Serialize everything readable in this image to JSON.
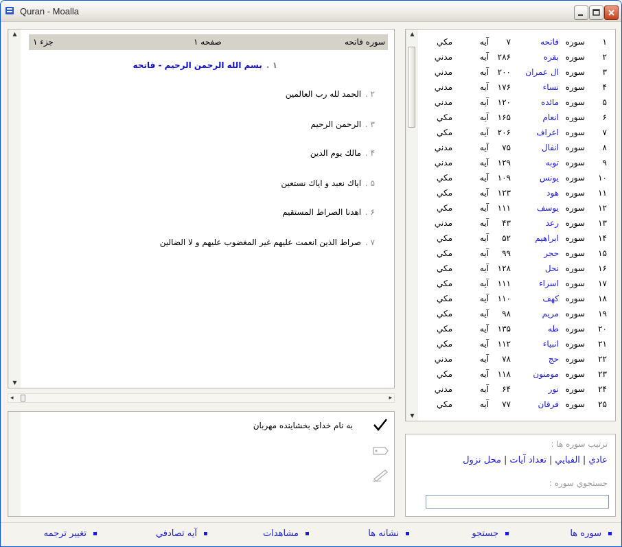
{
  "window": {
    "title": "Quran - Moalla"
  },
  "reader": {
    "header": {
      "surah": "سوره فاتحه",
      "page": "صفحه ۱",
      "juz": "جزء ۱"
    },
    "verses": [
      {
        "num": "۱ .",
        "text": "بسم الله الرحمن الرحيم - فاتحه"
      },
      {
        "num": "۲ .",
        "text": "الحمد لله رب العالمين"
      },
      {
        "num": "۳ .",
        "text": "الرحمن الرحيم"
      },
      {
        "num": "۴ .",
        "text": "مالك يوم الدين"
      },
      {
        "num": "۵ .",
        "text": "اياك نعبد و اياك نستعين"
      },
      {
        "num": "۶ .",
        "text": "اهدنا الصراط المستقيم"
      },
      {
        "num": "۷ .",
        "text": "صراط الذين انعمت عليهم غير المغضوب عليهم و لا الضالين"
      }
    ]
  },
  "translation": {
    "text": "به نام خداي بخشاينده مهربان"
  },
  "surah_list": {
    "rows": [
      {
        "num": "۱",
        "word": "سوره",
        "name": "فاتحه",
        "count": "۷",
        "aye": "آيه",
        "place": "مكي"
      },
      {
        "num": "۲",
        "word": "سوره",
        "name": "بقره",
        "count": "۲۸۶",
        "aye": "آيه",
        "place": "مدني"
      },
      {
        "num": "۳",
        "word": "سوره",
        "name": "ال عمران",
        "count": "۲۰۰",
        "aye": "آيه",
        "place": "مدني"
      },
      {
        "num": "۴",
        "word": "سوره",
        "name": "نساء",
        "count": "۱۷۶",
        "aye": "آيه",
        "place": "مدني"
      },
      {
        "num": "۵",
        "word": "سوره",
        "name": "مائده",
        "count": "۱۲۰",
        "aye": "آيه",
        "place": "مدني"
      },
      {
        "num": "۶",
        "word": "سوره",
        "name": "انعام",
        "count": "۱۶۵",
        "aye": "آيه",
        "place": "مكي"
      },
      {
        "num": "۷",
        "word": "سوره",
        "name": "اعراف",
        "count": "۲۰۶",
        "aye": "آيه",
        "place": "مكي"
      },
      {
        "num": "۸",
        "word": "سوره",
        "name": "انفال",
        "count": "۷۵",
        "aye": "آيه",
        "place": "مدني"
      },
      {
        "num": "۹",
        "word": "سوره",
        "name": "توبه",
        "count": "۱۲۹",
        "aye": "آيه",
        "place": "مدني"
      },
      {
        "num": "۱۰",
        "word": "سوره",
        "name": "يونس",
        "count": "۱۰۹",
        "aye": "آيه",
        "place": "مكي"
      },
      {
        "num": "۱۱",
        "word": "سوره",
        "name": "هود",
        "count": "۱۲۳",
        "aye": "آيه",
        "place": "مكي"
      },
      {
        "num": "۱۲",
        "word": "سوره",
        "name": "يوسف",
        "count": "۱۱۱",
        "aye": "آيه",
        "place": "مكي"
      },
      {
        "num": "۱۳",
        "word": "سوره",
        "name": "رعد",
        "count": "۴۳",
        "aye": "آيه",
        "place": "مدني"
      },
      {
        "num": "۱۴",
        "word": "سوره",
        "name": "ابراهيم",
        "count": "۵۲",
        "aye": "آيه",
        "place": "مكي"
      },
      {
        "num": "۱۵",
        "word": "سوره",
        "name": "حجر",
        "count": "۹۹",
        "aye": "آيه",
        "place": "مكي"
      },
      {
        "num": "۱۶",
        "word": "سوره",
        "name": "نحل",
        "count": "۱۲۸",
        "aye": "آيه",
        "place": "مكي"
      },
      {
        "num": "۱۷",
        "word": "سوره",
        "name": "اسراء",
        "count": "۱۱۱",
        "aye": "آيه",
        "place": "مكي"
      },
      {
        "num": "۱۸",
        "word": "سوره",
        "name": "كهف",
        "count": "۱۱۰",
        "aye": "آيه",
        "place": "مكي"
      },
      {
        "num": "۱۹",
        "word": "سوره",
        "name": "مريم",
        "count": "۹۸",
        "aye": "آيه",
        "place": "مكي"
      },
      {
        "num": "۲۰",
        "word": "سوره",
        "name": "طه",
        "count": "۱۳۵",
        "aye": "آيه",
        "place": "مكي"
      },
      {
        "num": "۲۱",
        "word": "سوره",
        "name": "انبياء",
        "count": "۱۱۲",
        "aye": "آيه",
        "place": "مكي"
      },
      {
        "num": "۲۲",
        "word": "سوره",
        "name": "حج",
        "count": "۷۸",
        "aye": "آيه",
        "place": "مدني"
      },
      {
        "num": "۲۳",
        "word": "سوره",
        "name": "مومنون",
        "count": "۱۱۸",
        "aye": "آيه",
        "place": "مكي"
      },
      {
        "num": "۲۴",
        "word": "سوره",
        "name": "نور",
        "count": "۶۴",
        "aye": "آيه",
        "place": "مدني"
      },
      {
        "num": "۲۵",
        "word": "سوره",
        "name": "فرقان",
        "count": "۷۷",
        "aye": "آيه",
        "place": "مكي"
      }
    ]
  },
  "options": {
    "order_label": "ترتيب سوره ها :",
    "order_links": [
      "عادي",
      "الفبايي",
      "تعداد آيات",
      "محل نزول"
    ],
    "search_label": "جستجوي سوره :",
    "search_value": ""
  },
  "bottom_nav": [
    "سوره ها",
    "جستجو",
    "نشانه ها",
    "مشاهدات",
    "آيه تصادفي",
    "تغيير ترجمه"
  ],
  "colors": {
    "link": "#1a1ad8",
    "verse_title": "#1010c8",
    "header_band": "#d5d2ca"
  }
}
